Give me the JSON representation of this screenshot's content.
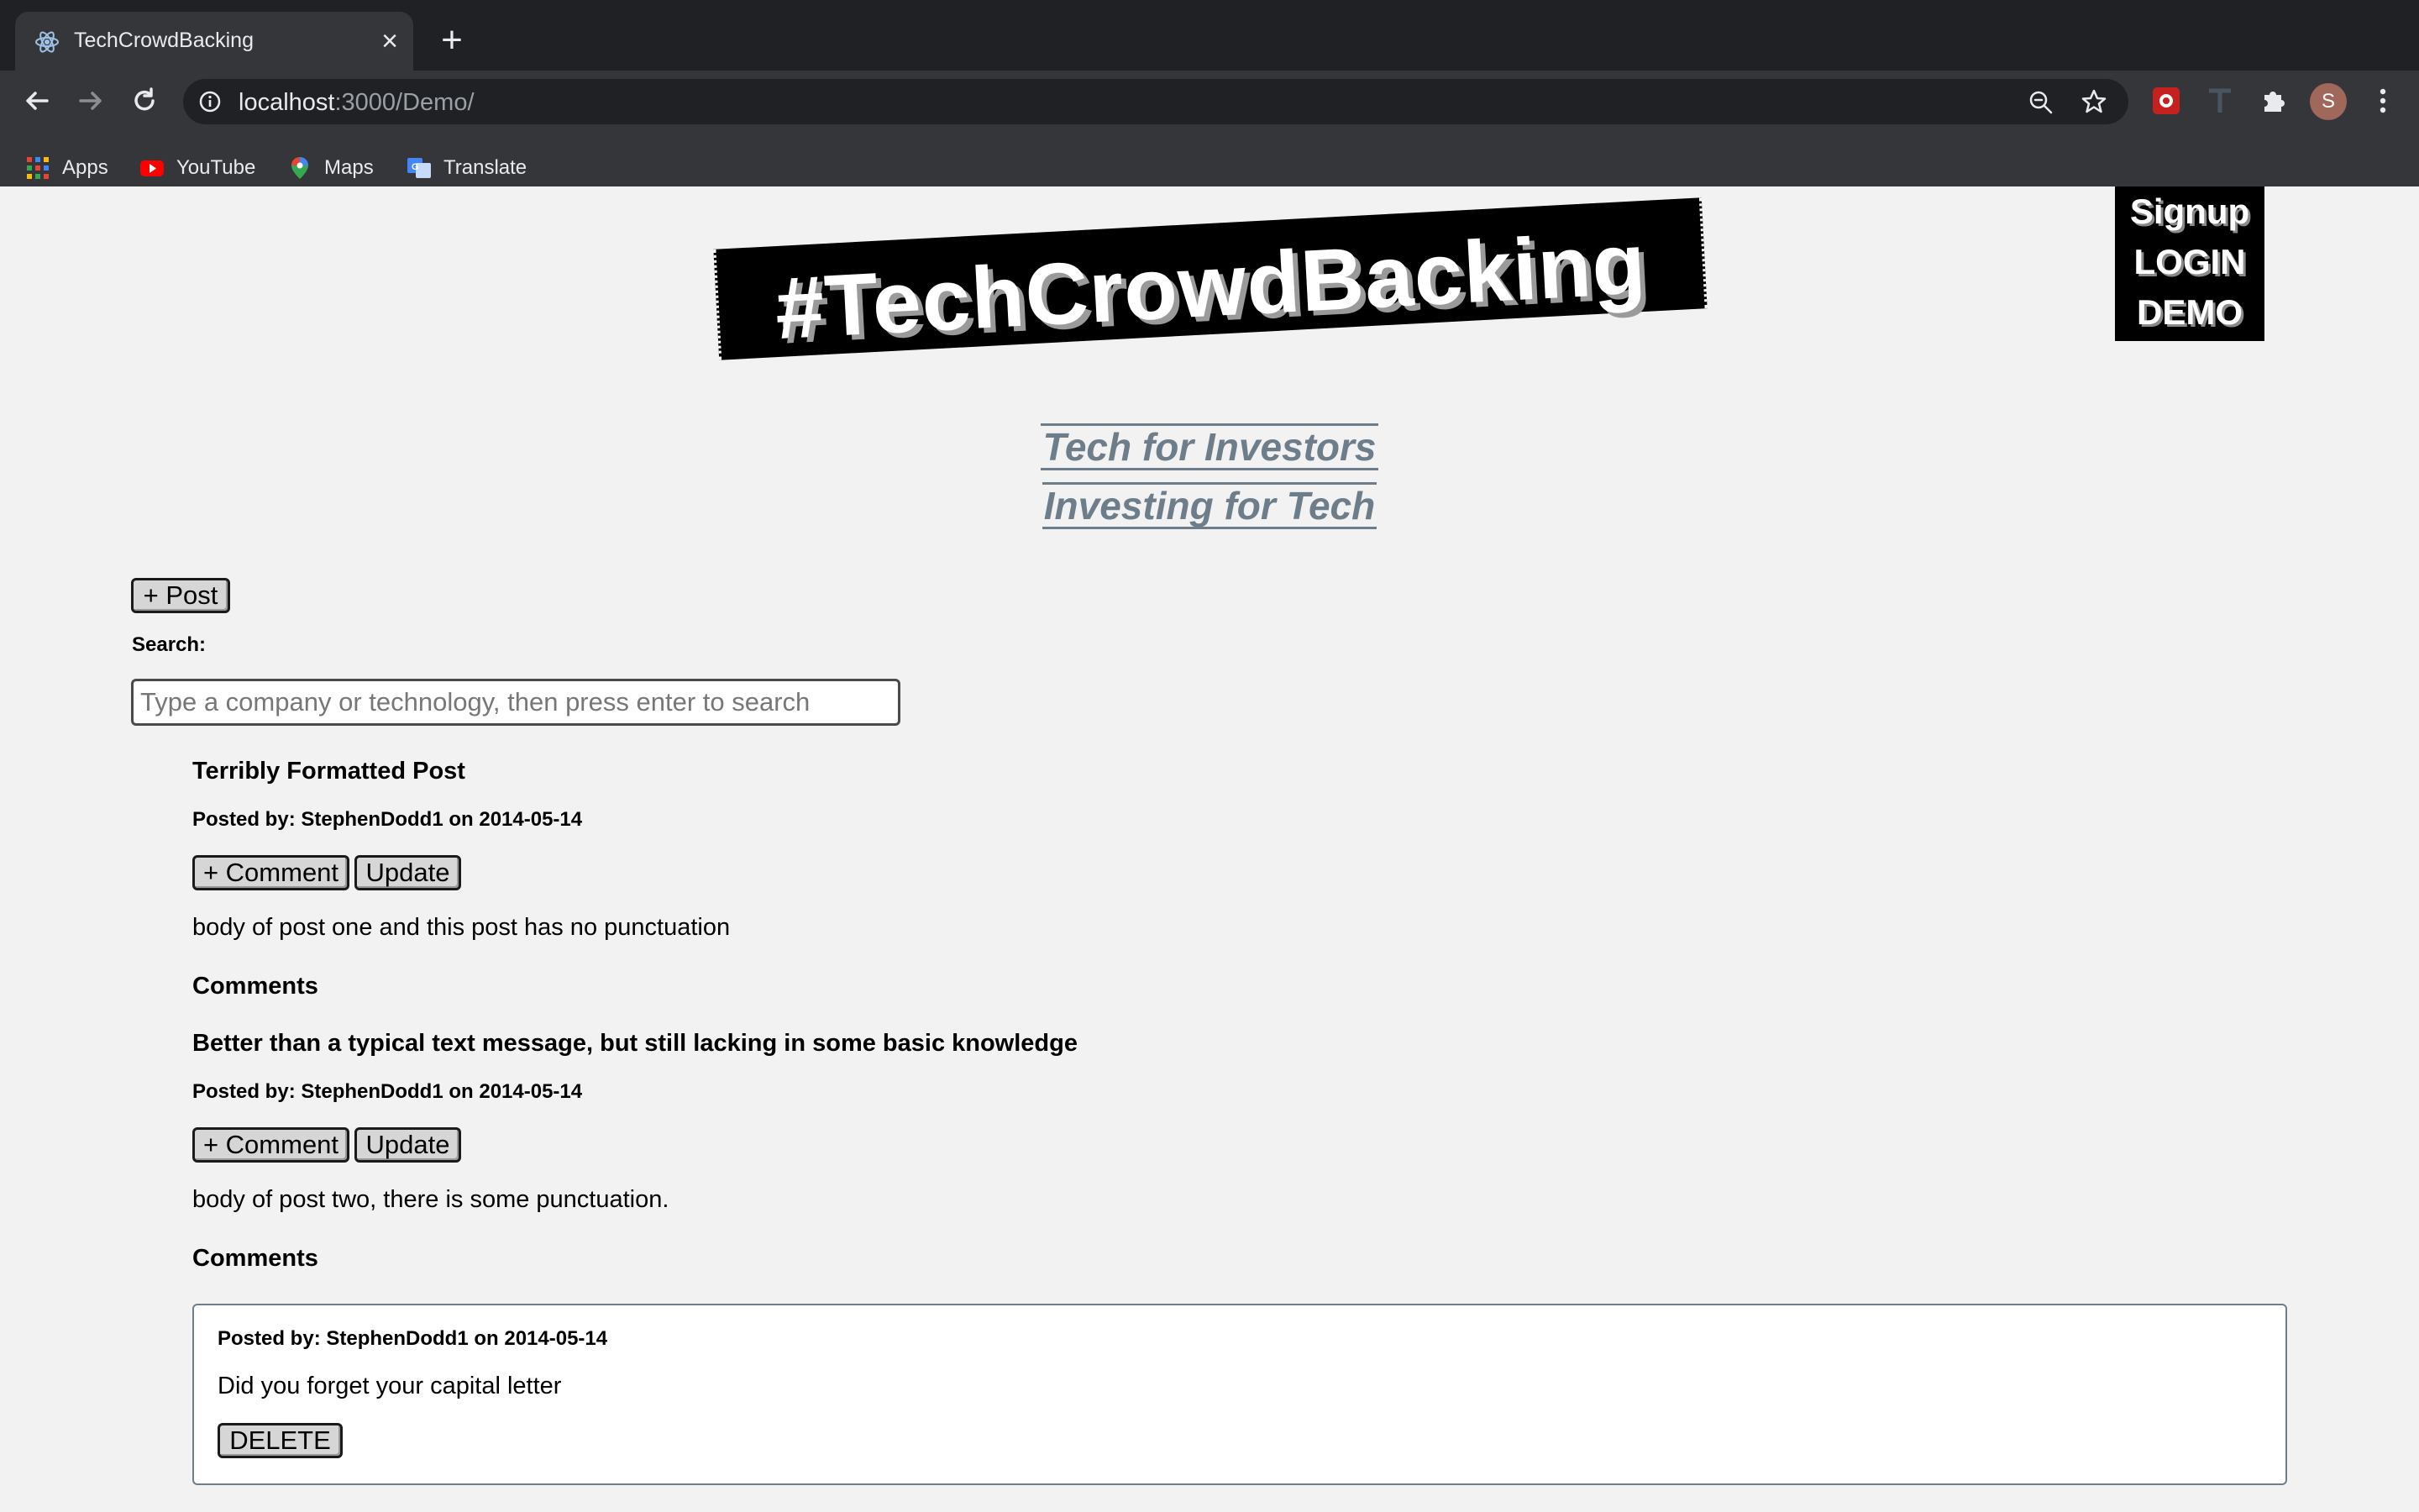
{
  "browser": {
    "tab_title": "TechCrowdBacking",
    "url_host": "localhost",
    "url_path": ":3000/Demo/",
    "avatar_letter": "S",
    "bookmarks": [
      {
        "label": "Apps"
      },
      {
        "label": "YouTube"
      },
      {
        "label": "Maps"
      },
      {
        "label": "Translate"
      }
    ]
  },
  "site": {
    "logo_text": "#TechCrowdBacking",
    "auth_links": {
      "signup": "Signup",
      "login": "LOGIN",
      "demo": "DEMO"
    },
    "tagline_1": "Tech for Investors",
    "tagline_2": "Investing for Tech"
  },
  "controls": {
    "post_button": "+ Post",
    "search_label": "Search:",
    "search_placeholder": "Type a company or technology, then press enter to search",
    "search_value": ""
  },
  "posts": [
    {
      "title": "Terribly Formatted Post",
      "meta": "Posted by: StephenDodd1 on 2014-05-14",
      "comment_button": "+ Comment",
      "update_button": "Update",
      "body": "body of post one and this post has no punctuation",
      "comments_heading": "Comments"
    },
    {
      "title": "Better than a typical text message, but still lacking in some basic knowledge",
      "meta": "Posted by: StephenDodd1 on 2014-05-14",
      "comment_button": "+ Comment",
      "update_button": "Update",
      "body": "body of post two, there is some punctuation.",
      "comments_heading": "Comments",
      "comments": [
        {
          "meta": "Posted by: StephenDodd1 on 2014-05-14",
          "text": "Did you forget your capital letter",
          "delete_button": "DELETE"
        }
      ]
    }
  ]
}
